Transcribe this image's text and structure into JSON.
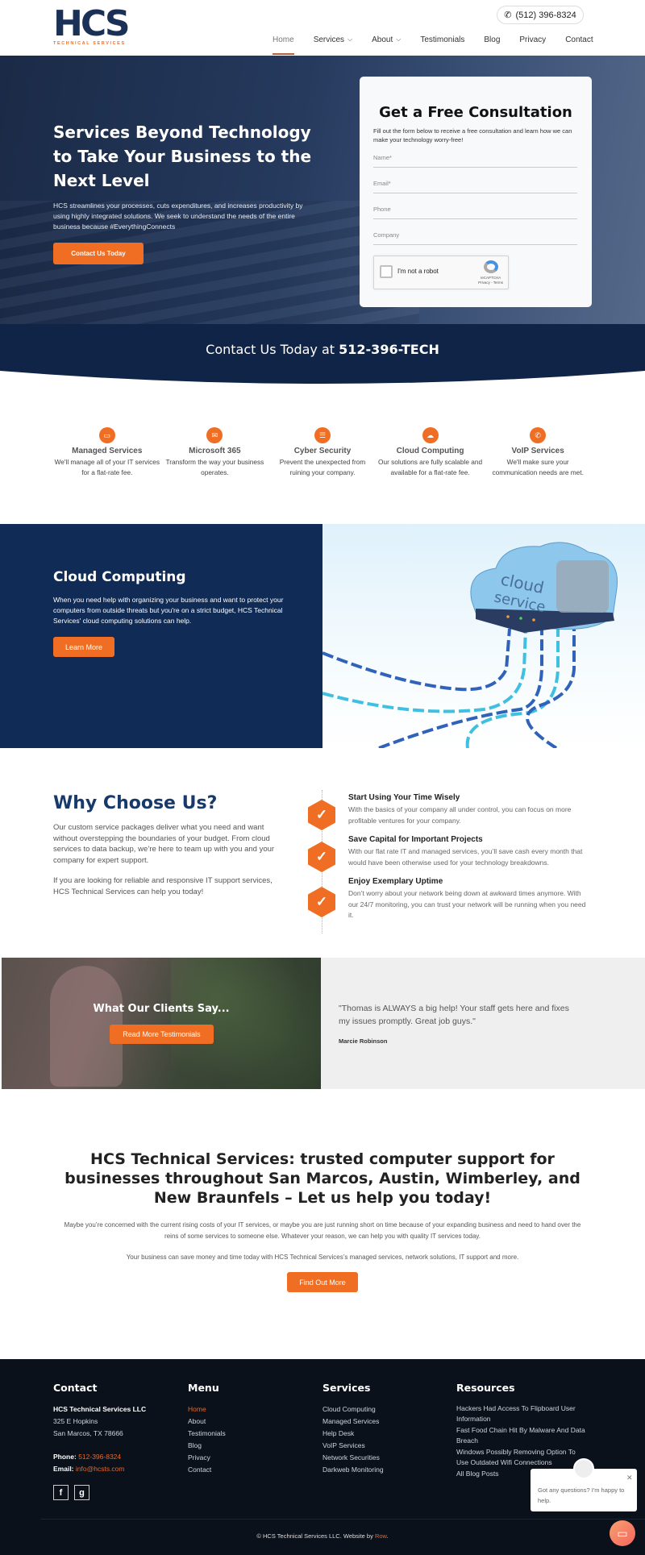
{
  "header": {
    "logo_main": "HCS",
    "logo_sub": "TECHNICAL SERVICES",
    "phone": "(512) 396-8324",
    "nav": [
      {
        "label": "Home",
        "active": true,
        "dropdown": false
      },
      {
        "label": "Services",
        "active": false,
        "dropdown": true
      },
      {
        "label": "About",
        "active": false,
        "dropdown": true
      },
      {
        "label": "Testimonials",
        "active": false,
        "dropdown": false
      },
      {
        "label": "Blog",
        "active": false,
        "dropdown": false
      },
      {
        "label": "Privacy",
        "active": false,
        "dropdown": false
      },
      {
        "label": "Contact",
        "active": false,
        "dropdown": false
      }
    ]
  },
  "hero": {
    "title": "Services Beyond Technology to Take Your Business to the Next Level",
    "text": "HCS streamlines your processes, cuts expenditures, and increases productivity by using highly integrated solutions. We seek to understand the needs of the entire business because #EverythingConnects",
    "button": "Contact Us Today"
  },
  "form": {
    "title": "Get a Free Consultation",
    "description": "Fill out the form below to receive a free consultation and learn how we can make your technology worry-free!",
    "fields": {
      "name": {
        "placeholder": "Name*",
        "value": ""
      },
      "email": {
        "placeholder": "Email*",
        "value": ""
      },
      "phone": {
        "placeholder": "Phone",
        "value": ""
      },
      "company": {
        "placeholder": "Company",
        "value": ""
      }
    },
    "captcha": {
      "label": "I'm not a robot",
      "brand": "reCAPTCHA",
      "links": "Privacy - Terms"
    }
  },
  "strip": {
    "prefix": "Contact Us Today at ",
    "number": "512-396-TECH"
  },
  "services": [
    {
      "icon": "monitor-icon",
      "glyph": "▭",
      "title": "Managed Services",
      "desc": "We'll manage all of your IT services for a flat-rate fee."
    },
    {
      "icon": "envelope-icon",
      "glyph": "✉",
      "title": "Microsoft 365",
      "desc": "Transform the way your business operates."
    },
    {
      "icon": "server-icon",
      "glyph": "☰",
      "title": "Cyber Security",
      "desc": "Prevent the unexpected from ruining your company."
    },
    {
      "icon": "cloud-icon",
      "glyph": "☁",
      "title": "Cloud Computing",
      "desc": "Our solutions are fully scalable and available for a flat-rate fee."
    },
    {
      "icon": "phone-icon",
      "glyph": "✆",
      "title": "VoIP Services",
      "desc": "We'll make sure your communication needs are met."
    }
  ],
  "cloud": {
    "title": "Cloud Computing",
    "text": "When you need help with organizing your business and want to protect your computers from outside threats but you're on a strict budget, HCS Technical Services' cloud computing solutions can help.",
    "button": "Learn More",
    "image_label_1": "cloud",
    "image_label_2": "service"
  },
  "why": {
    "title": "Why Choose Us?",
    "p1": "Our custom service packages deliver what you need and want without overstepping the boundaries of your budget. From cloud services to data backup, we’re here to team up with you and your company for expert support.",
    "p2": "If you are looking for reliable and responsive IT support services, HCS Technical Services can help you today!",
    "items": [
      {
        "title": "Start Using Your Time Wisely",
        "desc": "With the basics of your company all under control, you can focus on more profitable ventures for your company."
      },
      {
        "title": "Save Capital for Important Projects",
        "desc": "With our flat rate IT and managed services, you’ll save cash every month that would have been otherwise used for your technology breakdowns."
      },
      {
        "title": "Enjoy Exemplary Uptime",
        "desc": "Don’t worry about your network being down at awkward times anymore. With our 24/7 monitoring, you can trust your network will be running when you need it."
      }
    ]
  },
  "testimonials": {
    "title": "What Our Clients Say...",
    "button": "Read More Testimonials",
    "quote": "\"Thomas is ALWAYS a big help! Your staff gets here and fixes my issues promptly. Great job guys.\"",
    "author": "Marcie Robinson"
  },
  "cta": {
    "title": "HCS Technical Services: trusted computer support for businesses throughout San Marcos, Austin, Wimberley, and New Braunfels – Let us help you today!",
    "p1": "Maybe you’re concerned with the current rising costs of your IT services, or maybe you are just running short on time because of your expanding business and need to hand over the reins of some services to someone else. Whatever your reason, we can help you with quality IT services today.",
    "p2": "Your business can save money and time today with HCS Technical Services’s managed services, network solutions, IT support and more.",
    "button": "Find Out More"
  },
  "footer": {
    "contact": {
      "heading": "Contact",
      "company": "HCS Technical Services LLC",
      "address1": "325 E Hopkins",
      "address2": "San Marcos, TX 78666",
      "phone_label": "Phone:",
      "phone": "512-396-8324",
      "email_label": "Email:",
      "email": "info@hcsts.com",
      "social": [
        {
          "icon": "facebook-icon",
          "glyph": "f"
        },
        {
          "icon": "google-icon",
          "glyph": "g"
        }
      ]
    },
    "menu": {
      "heading": "Menu",
      "items": [
        "Home",
        "About",
        "Testimonials",
        "Blog",
        "Privacy",
        "Contact"
      ]
    },
    "services": {
      "heading": "Services",
      "items": [
        "Cloud Computing",
        "Managed Services",
        "Help Desk",
        "VoIP Services",
        "Network Securities",
        "Darkweb Monitoring"
      ]
    },
    "resources": {
      "heading": "Resources",
      "items": [
        "Hackers Had Access To Flipboard User Information",
        "Fast Food Chain Hit By Malware And Data Breach",
        "Windows Possibly Removing Option To Use Outdated Wifi Connections",
        "All Blog Posts"
      ]
    },
    "copyright": "© HCS Technical Services LLC. Website by ",
    "credit": "Row",
    "credit_end": "."
  },
  "chat": {
    "message": "Got any questions? I'm happy to help."
  },
  "colors": {
    "accent": "#f06e23",
    "navy": "#0f2447",
    "footer": "#0b111b"
  }
}
